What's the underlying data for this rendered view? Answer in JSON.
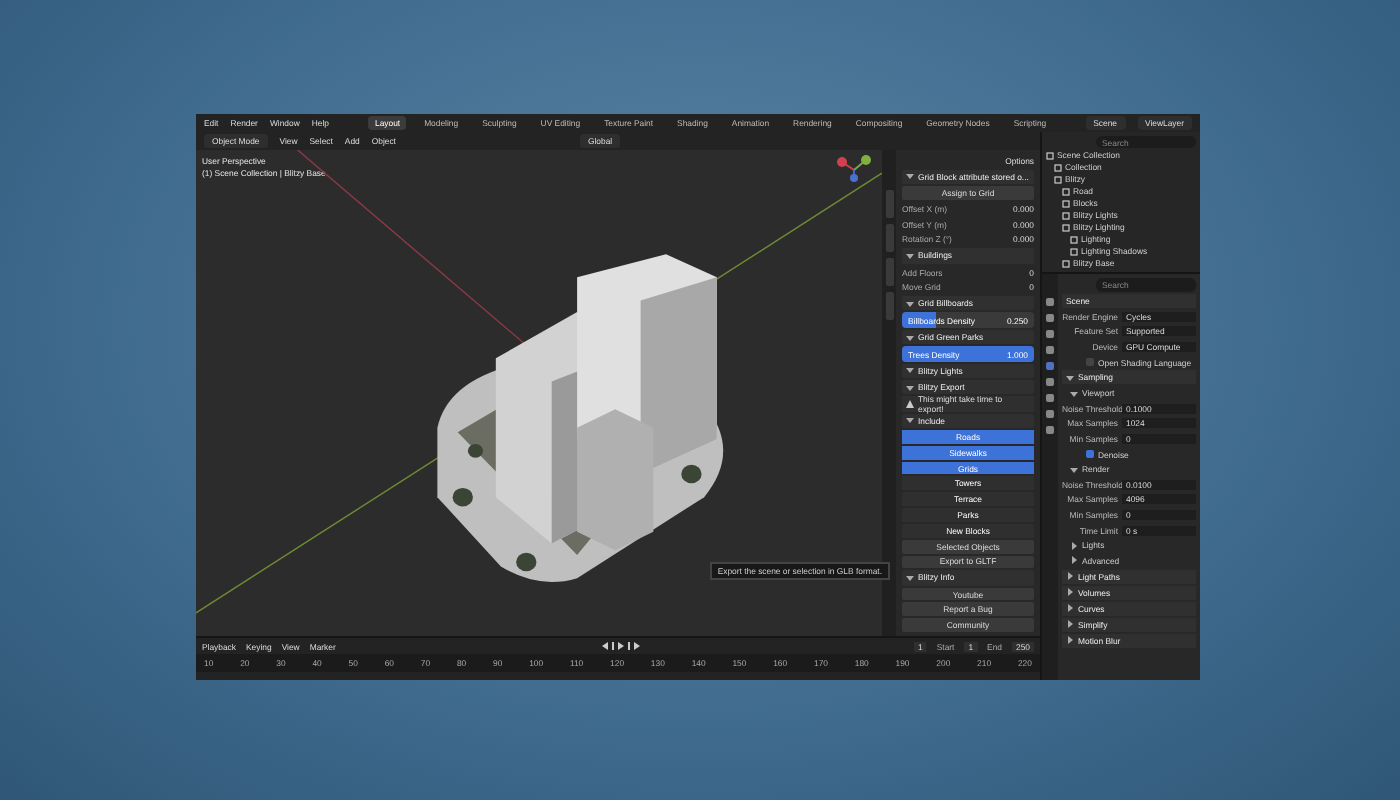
{
  "menu": [
    "Edit",
    "Render",
    "Window",
    "Help"
  ],
  "workspaces": [
    {
      "label": "Layout",
      "selected": true
    },
    {
      "label": "Modeling",
      "selected": false
    },
    {
      "label": "Sculpting",
      "selected": false
    },
    {
      "label": "UV Editing",
      "selected": false
    },
    {
      "label": "Texture Paint",
      "selected": false
    },
    {
      "label": "Shading",
      "selected": false
    },
    {
      "label": "Animation",
      "selected": false
    },
    {
      "label": "Rendering",
      "selected": false
    },
    {
      "label": "Compositing",
      "selected": false
    },
    {
      "label": "Geometry Nodes",
      "selected": false
    },
    {
      "label": "Scripting",
      "selected": false
    }
  ],
  "scene_selector": {
    "scene": "Scene",
    "view_layer": "ViewLayer"
  },
  "header": {
    "mode": "Object Mode",
    "menus": [
      "View",
      "Select",
      "Add",
      "Object"
    ],
    "orientation": "Global"
  },
  "viewport": {
    "overlay": [
      "User Perspective",
      "(1) Scene Collection | Blitzy Base"
    ]
  },
  "sidebar": {
    "options": "Options",
    "items": [
      {
        "kind": "header",
        "label": "Grid Block attribute stored o..."
      },
      {
        "kind": "button",
        "label": "Assign to Grid"
      },
      {
        "kind": "field",
        "label": "Offset X (m)",
        "value": "0.000"
      },
      {
        "kind": "field",
        "label": "Offset Y (m)",
        "value": "0.000"
      },
      {
        "kind": "field",
        "label": "Rotation Z (°)",
        "value": "0.000"
      },
      {
        "kind": "header",
        "label": "Buildings"
      },
      {
        "kind": "field",
        "label": "Add Floors",
        "value": "0"
      },
      {
        "kind": "field",
        "label": "Move Grid",
        "value": "0"
      },
      {
        "kind": "header",
        "label": "Grid Billboards"
      },
      {
        "kind": "slider",
        "label": "Billboards Density",
        "value": "0.250",
        "level": 0.25
      },
      {
        "kind": "header",
        "label": "Grid Green Parks"
      },
      {
        "kind": "slider",
        "label": "Trees Density",
        "value": "1.000",
        "level": 1
      },
      {
        "kind": "header",
        "label": "Blitzy Lights"
      },
      {
        "kind": "header",
        "label": "Blitzy Export"
      },
      {
        "kind": "note",
        "label": "This might take time to export!"
      },
      {
        "kind": "header",
        "label": "Include"
      },
      {
        "kind": "toggle",
        "label": "Roads",
        "selected": true
      },
      {
        "kind": "toggle",
        "label": "Sidewalks",
        "selected": true
      },
      {
        "kind": "toggle",
        "label": "Grids",
        "selected": true
      },
      {
        "kind": "toggle",
        "label": "Towers",
        "selected": false
      },
      {
        "kind": "toggle",
        "label": "Terrace",
        "selected": false
      },
      {
        "kind": "toggle",
        "label": "Parks",
        "selected": false
      },
      {
        "kind": "toggle",
        "label": "New Blocks",
        "selected": false
      },
      {
        "kind": "button",
        "label": "Selected Objects"
      },
      {
        "kind": "button",
        "label": "Export to GLTF"
      },
      {
        "kind": "header",
        "label": "Blitzy Info"
      },
      {
        "kind": "button",
        "label": "Youtube"
      },
      {
        "kind": "button",
        "label": "Report a Bug"
      },
      {
        "kind": "button",
        "label": "Community"
      }
    ]
  },
  "tooltip": "Export the scene or selection in GLB format.",
  "outliner": {
    "search": {
      "placeholder": "Search"
    },
    "tree": [
      {
        "label": "Scene Collection",
        "children": [
          {
            "label": "Collection"
          },
          {
            "label": "Blitzy",
            "children": [
              {
                "label": "Road"
              },
              {
                "label": "Blocks"
              },
              {
                "label": "Blitzy Lights"
              },
              {
                "label": "Blitzy Lighting",
                "children": [
                  {
                    "label": "Lighting"
                  },
                  {
                    "label": "Lighting Shadows"
                  }
                ]
              },
              {
                "label": "Blitzy Base"
              }
            ]
          }
        ]
      }
    ]
  },
  "properties": {
    "search": {
      "placeholder": "Search"
    },
    "items": [
      {
        "kind": "title",
        "label": "Scene"
      },
      {
        "kind": "field",
        "label": "Render Engine",
        "value": "Cycles"
      },
      {
        "kind": "field",
        "label": "Feature Set",
        "value": "Supported"
      },
      {
        "kind": "field",
        "label": "Device",
        "value": "GPU Compute"
      },
      {
        "kind": "check",
        "label": "Open Shading Language",
        "checked": false
      },
      {
        "kind": "section",
        "label": "Sampling",
        "expanded": true
      },
      {
        "kind": "sub",
        "label": "Viewport",
        "expanded": true
      },
      {
        "kind": "field",
        "label": "Noise Threshold",
        "value": "0.1000"
      },
      {
        "kind": "field",
        "label": "Max Samples",
        "value": "1024"
      },
      {
        "kind": "field",
        "label": "Min Samples",
        "value": "0"
      },
      {
        "kind": "check",
        "label": "Denoise",
        "checked": true
      },
      {
        "kind": "sub",
        "label": "Render",
        "expanded": true
      },
      {
        "kind": "field",
        "label": "Noise Threshold",
        "value": "0.0100"
      },
      {
        "kind": "field",
        "label": "Max Samples",
        "value": "4096"
      },
      {
        "kind": "field",
        "label": "Min Samples",
        "value": "0"
      },
      {
        "kind": "field",
        "label": "Time Limit",
        "value": "0 s"
      },
      {
        "kind": "sub",
        "label": "Lights",
        "expanded": false
      },
      {
        "kind": "sub",
        "label": "Advanced",
        "expanded": false
      },
      {
        "kind": "section",
        "label": "Light Paths",
        "expanded": false
      },
      {
        "kind": "section",
        "label": "Volumes",
        "expanded": false
      },
      {
        "kind": "section",
        "label": "Curves",
        "expanded": false
      },
      {
        "kind": "section",
        "label": "Simplify",
        "expanded": false
      },
      {
        "kind": "section",
        "label": "Motion Blur",
        "expanded": false
      }
    ]
  },
  "timeline": {
    "menus": [
      "Playback",
      "Keying",
      "View",
      "Marker"
    ],
    "current_frame": "1",
    "start_label": "Start",
    "start": "1",
    "end_label": "End",
    "end": "250",
    "ticks": [
      "10",
      "20",
      "30",
      "40",
      "50",
      "60",
      "70",
      "80",
      "90",
      "100",
      "110",
      "120",
      "130",
      "140",
      "150",
      "160",
      "170",
      "180",
      "190",
      "200",
      "210",
      "220"
    ]
  }
}
